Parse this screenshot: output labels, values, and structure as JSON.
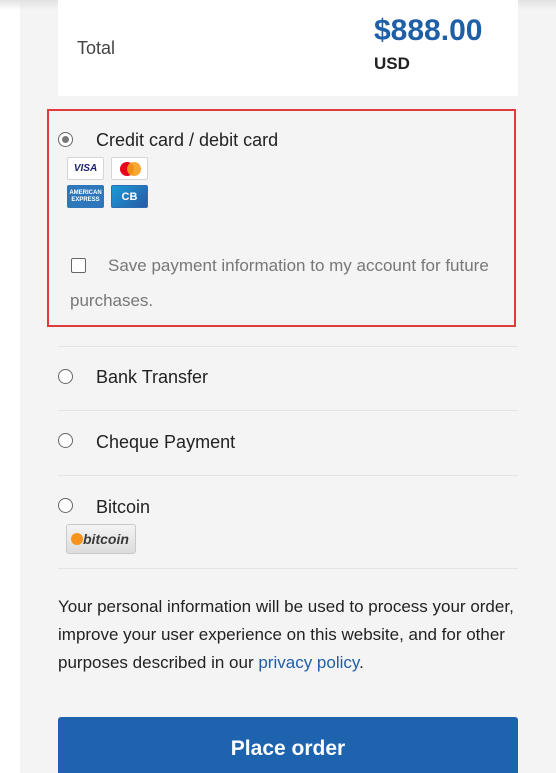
{
  "order_total": {
    "label": "Total",
    "amount": "$888.00",
    "currency": "USD"
  },
  "payment_methods": [
    {
      "label": "Credit card / debit card",
      "selected": true,
      "icons": [
        "visa-card-icon",
        "mastercard-icon",
        "american-express-card-icon",
        "cb-card-icon"
      ]
    },
    {
      "label": "Bank Transfer",
      "selected": false
    },
    {
      "label": "Cheque Payment",
      "selected": false
    },
    {
      "label": "Bitcoin",
      "selected": false,
      "icons": [
        "bitcoin-logo-icon"
      ]
    }
  ],
  "card_icons": {
    "visa": "VISA",
    "amex_line1": "AMERICAN",
    "amex_line2": "EXPRESS",
    "cb": "CB",
    "bitcoin": "bitcoin"
  },
  "save_payment": {
    "label": "Save payment information to my account for future purchases.",
    "checked": false
  },
  "privacy_notice": {
    "text_before": "Your personal information will be used to process your order, improve your user experience on this website, and for other purposes described in our ",
    "link": "privacy policy",
    "text_after": "."
  },
  "place_order_label": "Place order",
  "colors": {
    "accent": "#1e63ad",
    "highlight_border": "#e0393e",
    "link": "#1f5fa6"
  }
}
